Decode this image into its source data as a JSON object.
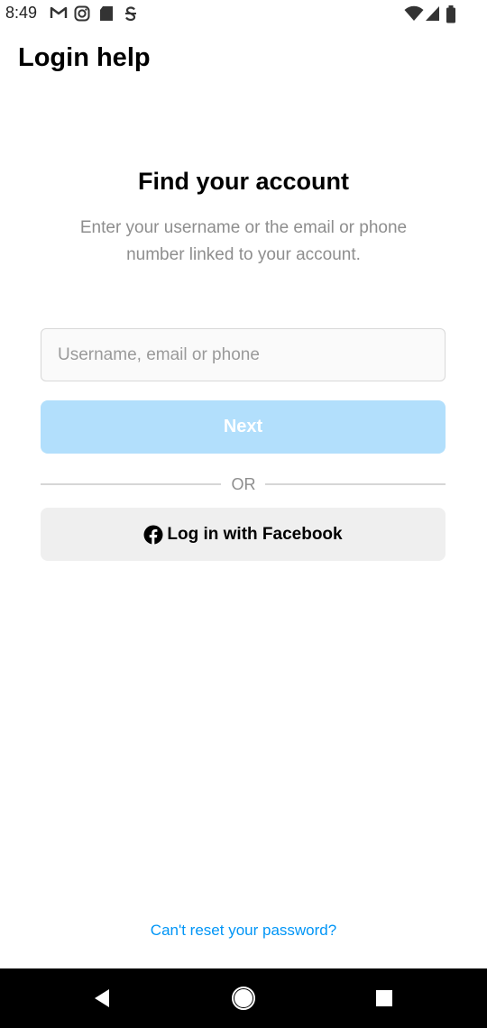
{
  "status_bar": {
    "time": "8:49",
    "left_icons": [
      "gmail-icon",
      "instagram-icon",
      "sd-card-icon",
      "store-icon"
    ],
    "right_icons": [
      "wifi-icon",
      "cell-signal-icon",
      "battery-icon"
    ]
  },
  "header": {
    "title": "Login help"
  },
  "main": {
    "heading": "Find your account",
    "subtitle": "Enter your username or the email or phone number linked to your account.",
    "input": {
      "placeholder": "Username, email or phone",
      "value": ""
    },
    "next_label": "Next",
    "divider_text": "OR",
    "facebook_label": "Log in with Facebook",
    "facebook_icon": "facebook-icon"
  },
  "footer": {
    "reset_link": "Can't reset your password?"
  },
  "nav_bar": {
    "icons": [
      "back-icon",
      "home-icon",
      "recents-icon"
    ]
  },
  "colors": {
    "accent": "#0095f6",
    "next_disabled": "#b2dffc",
    "facebook_button_bg": "#efefef",
    "muted_text": "#8e8e8e"
  }
}
